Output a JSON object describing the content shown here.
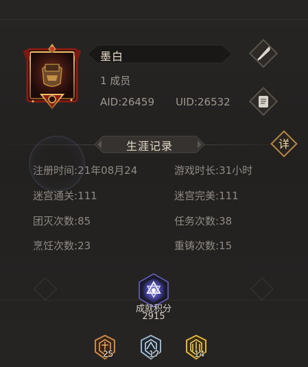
{
  "guild": {
    "name": "墨白",
    "members": "1 成员",
    "aid": "AID:26459",
    "uid": "UID:26532"
  },
  "buttons": {
    "edit_icon": "quill-icon",
    "doc_icon": "scroll-document-icon",
    "detail_label": "详"
  },
  "career": {
    "title": "生涯记录",
    "stats": [
      {
        "label": "注册时间:",
        "value": "21年08月24"
      },
      {
        "label": "游戏时长:",
        "value": "31小时"
      },
      {
        "label": "迷宫通关:",
        "value": "111"
      },
      {
        "label": "迷宫完美:",
        "value": "111"
      },
      {
        "label": "团灭次数:",
        "value": "85"
      },
      {
        "label": "任务次数:",
        "value": "38"
      },
      {
        "label": "烹饪次数:",
        "value": "23"
      },
      {
        "label": "重铸次数:",
        "value": "15"
      }
    ]
  },
  "achievement": {
    "label": "成就积分",
    "value": "2915"
  },
  "medals": [
    {
      "tier": "bronze",
      "count": "25",
      "color": "#c98a4b"
    },
    {
      "tier": "silver",
      "count": "17",
      "color": "#9fb4c6"
    },
    {
      "tier": "gold",
      "count": "14",
      "color": "#e0b63c"
    }
  ],
  "colors": {
    "background": "#242221",
    "accent_gold": "#d4a35a",
    "emblem_red": "#8c1d14",
    "achievement_purple": "#5b58c9"
  }
}
